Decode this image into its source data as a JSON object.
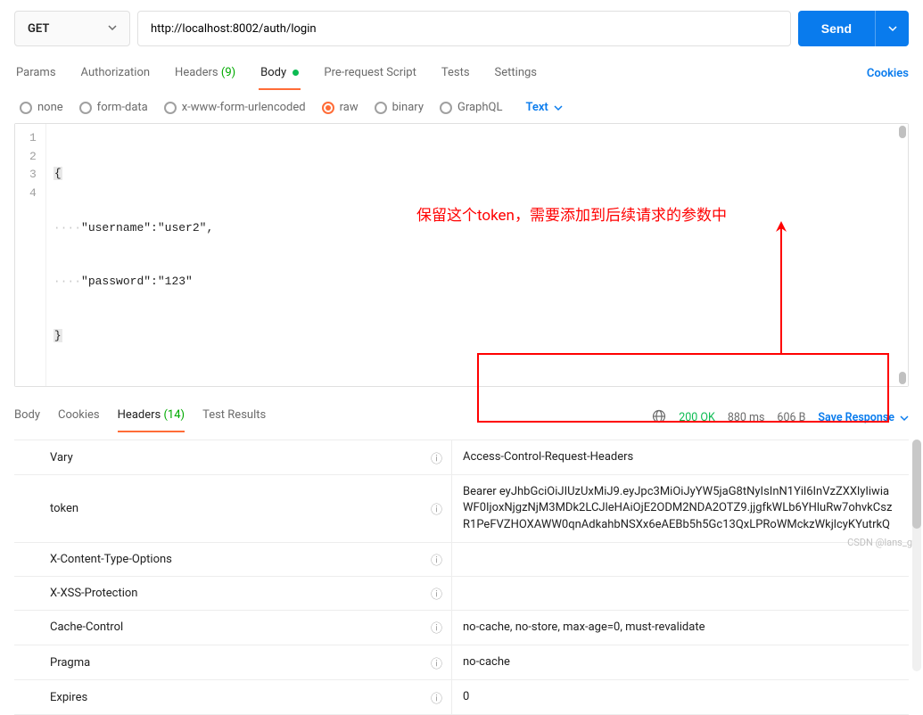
{
  "request": {
    "method": "GET",
    "url": "http://localhost:8002/auth/login",
    "send_label": "Send"
  },
  "tabs": {
    "params": "Params",
    "authorization": "Authorization",
    "headers": "Headers",
    "headers_count": "(9)",
    "body": "Body",
    "pre_request": "Pre-request Script",
    "tests": "Tests",
    "settings": "Settings",
    "cookies": "Cookies"
  },
  "body_types": {
    "none": "none",
    "form_data": "form-data",
    "urlencoded": "x-www-form-urlencoded",
    "raw": "raw",
    "binary": "binary",
    "graphql": "GraphQL",
    "content_type": "Text"
  },
  "editor": {
    "line1": "{",
    "line2_pre": "····",
    "line2_text": "\"username\":\"user2\",",
    "line3_pre": "····",
    "line3_text": "\"password\":\"123\"",
    "line4": "}"
  },
  "annotation": {
    "text": "保留这个token，需要添加到后续请求的参数中"
  },
  "response": {
    "tabs": {
      "body": "Body",
      "cookies": "Cookies",
      "headers": "Headers",
      "headers_count": "(14)",
      "test_results": "Test Results"
    },
    "status": "200 OK",
    "time": "880 ms",
    "size": "606 B",
    "save": "Save Response"
  },
  "headers": [
    {
      "key": "Vary",
      "value": "Access-Control-Request-Headers"
    },
    {
      "key": "token",
      "value": "Bearer eyJhbGciOiJIUzUxMiJ9.eyJpc3MiOiJyYW5jaG8tNyIsInN1Yil6InVzZXXlyIiwiaWF0IjoxNjgzNjM3MDk2LCJleHAiOjE2ODM2NDA2OTZ9.jjgfkWLb6YHluRw7ohvkCszR1PeFVZHOXAWW0qnAdkahbNSXx6eAEBb5h5Gc13QxLPRoWMckzWkjlcyKYutrkQ"
    },
    {
      "key": "X-Content-Type-Options",
      "value": ""
    },
    {
      "key": "X-XSS-Protection",
      "value": ""
    },
    {
      "key": "Cache-Control",
      "value": "no-cache, no-store, max-age=0, must-revalidate"
    },
    {
      "key": "Pragma",
      "value": "no-cache"
    },
    {
      "key": "Expires",
      "value": "0"
    }
  ],
  "watermark": "CSDN @lans_g"
}
